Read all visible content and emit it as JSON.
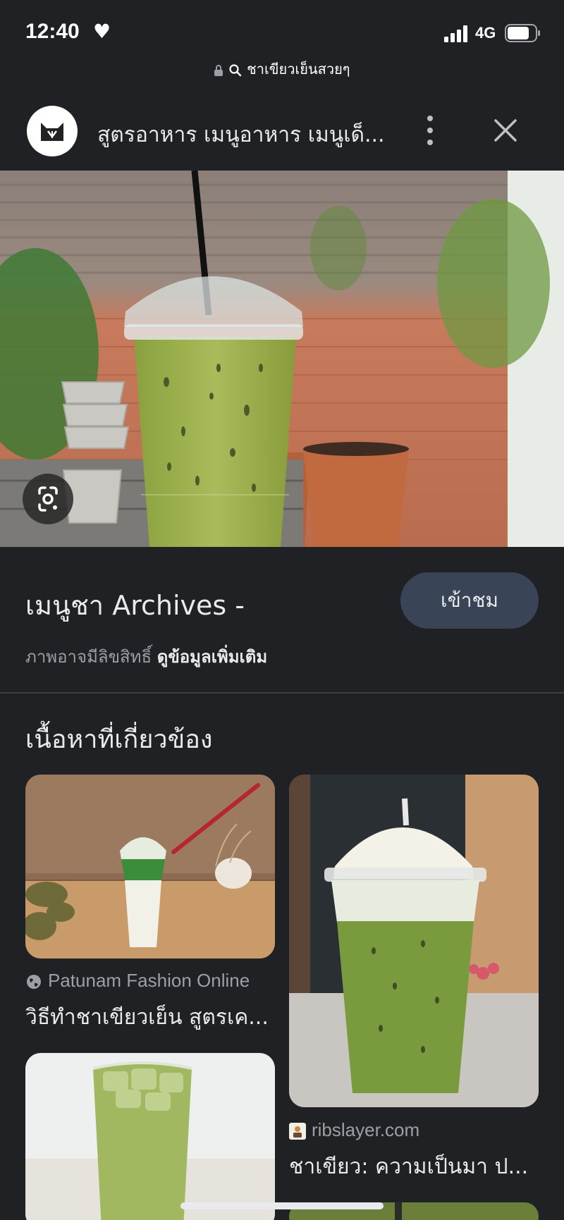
{
  "status_bar": {
    "time": "12:40",
    "network": "4G"
  },
  "url_bar": {
    "query": "ชาเขียวเย็นสวยๆ"
  },
  "source_header": {
    "title": "สูตรอาหาร เมนูอาหาร เมนูเด็..."
  },
  "result": {
    "title": "เมนูชา Archives -",
    "visit_label": "เข้าชม",
    "copyright_text": "ภาพอาจมีลิขสิทธิ์",
    "more_info_label": "ดูข้อมูลเพิ่มเติม"
  },
  "related": {
    "heading": "เนื้อหาที่เกี่ยวข้อง",
    "cards": [
      {
        "source": "Patunam Fashion Online",
        "title": "วิธีทำชาเขียวเย็น สูตรเค...",
        "icon": "globe-icon"
      },
      {
        "source": "ribslayer.com",
        "title": "ชาเขียว: ความเป็นมา ป...",
        "icon": "site-favicon"
      }
    ]
  },
  "colors": {
    "background": "#202124",
    "visit_button": "#394457",
    "secondary_text": "#9aa0a6",
    "matcha_green": "#9bb252"
  }
}
